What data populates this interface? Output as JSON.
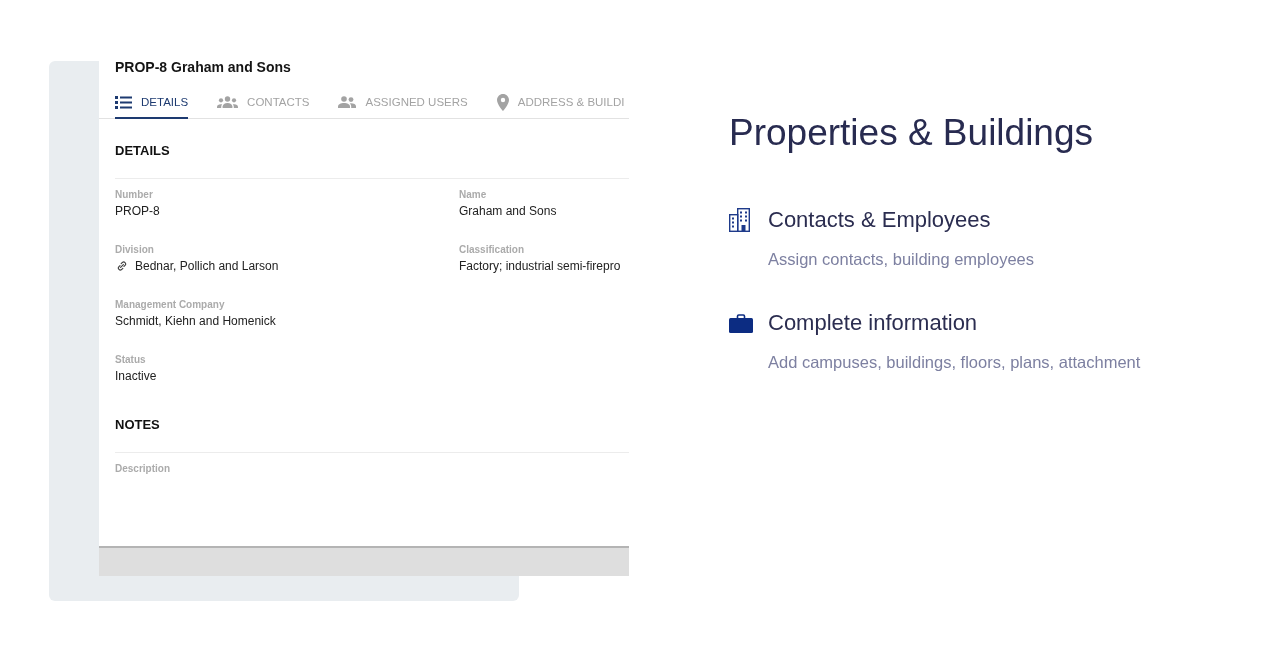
{
  "app_screenshot": {
    "title": "PROP-8 Graham and Sons",
    "tabs": [
      {
        "label": "DETAILS",
        "selected": true
      },
      {
        "label": "CONTACTS",
        "selected": false
      },
      {
        "label": "ASSIGNED USERS",
        "selected": false
      },
      {
        "label": "ADDRESS & BUILDI",
        "selected": false
      }
    ],
    "sections": [
      {
        "heading": "DETAILS",
        "rows": [
          [
            {
              "label": "Number",
              "value": "PROP-8",
              "linked": false
            },
            {
              "label": "Name",
              "value": "Graham and Sons",
              "linked": false
            }
          ],
          [
            {
              "label": "Division",
              "value": "Bednar, Pollich and Larson",
              "linked": true
            },
            {
              "label": "Classification",
              "value": "Factory; industrial semi-firepro",
              "linked": false
            }
          ],
          [
            {
              "label": "Management Company",
              "value": "Schmidt, Kiehn and Homenick",
              "linked": false
            }
          ],
          [
            {
              "label": "Status",
              "value": "Inactive",
              "linked": false
            }
          ]
        ]
      },
      {
        "heading": "NOTES",
        "rows": [
          [
            {
              "label": "Description"
            }
          ]
        ]
      }
    ]
  },
  "heading": "Properties & Buildings",
  "features": [
    {
      "title": "Contacts & Employees",
      "description": "Assign contacts, building employees"
    },
    {
      "title": "Complete information",
      "description": "Add campuses, buildings, floors, plans, attachment"
    }
  ]
}
